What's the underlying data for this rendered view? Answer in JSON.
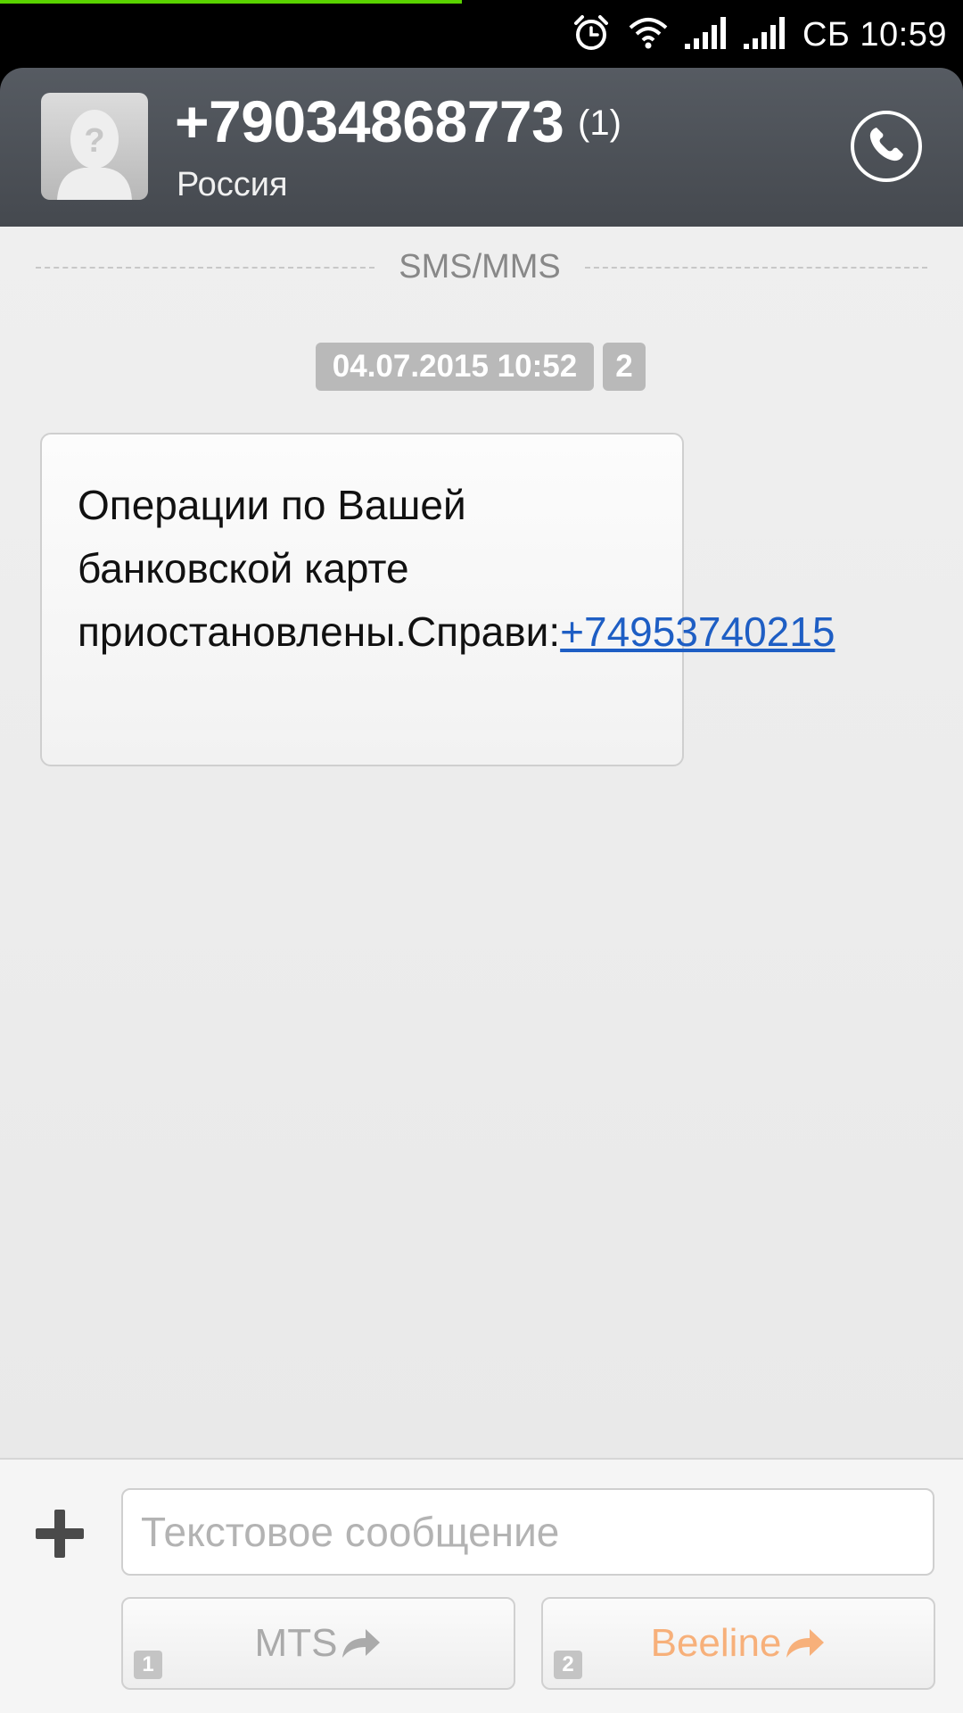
{
  "status_bar": {
    "day": "СБ",
    "time": "10:59",
    "progress": 0.48,
    "icons": [
      "alarm-icon",
      "wifi-icon",
      "signal-sim1-icon",
      "signal-sim2-icon"
    ],
    "progress_color": "#5ad200"
  },
  "header": {
    "number": "+79034868773",
    "unread": "(1)",
    "country": "Россия",
    "avatar_icon": "unknown-contact-icon",
    "call_icon": "phone-icon"
  },
  "conversation": {
    "divider_label": "SMS/MMS",
    "messages": [
      {
        "timestamp": "04.07.2015 10:52",
        "sim": "2",
        "text": "Операции по Вашей банковской карте приостановлены.Справи:",
        "link": "+74953740215"
      }
    ]
  },
  "composer": {
    "attach_icon": "plus-icon",
    "placeholder": "Текстовое сообщение",
    "send_buttons": [
      {
        "sim": "1",
        "label": "MTS",
        "color": "#aaaaaa"
      },
      {
        "sim": "2",
        "label": "Beeline",
        "color": "#f7b07a"
      }
    ]
  }
}
